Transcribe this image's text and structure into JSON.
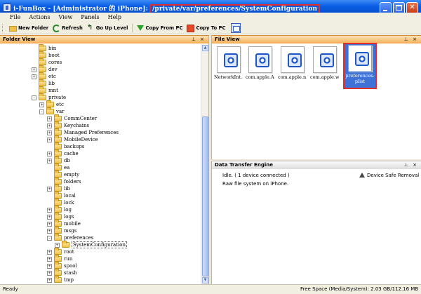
{
  "window": {
    "title_prefix": "i-FunBox - [Administrator 的 iPhone]:",
    "title_path": "/private/var/preferences/SystemConfiguration"
  },
  "menu": [
    "File",
    "Actions",
    "View",
    "Panels",
    "Help"
  ],
  "toolbar": {
    "new_folder": "New Folder",
    "refresh": "Refresh",
    "go_up": "Go Up Level",
    "copy_from_pc": "Copy From PC",
    "copy_to_pc": "Copy To PC"
  },
  "folder_view": {
    "title": "Folder View",
    "tree": [
      {
        "label": "bin",
        "expander": "none",
        "depth": 0
      },
      {
        "label": "boot",
        "expander": "none",
        "depth": 0
      },
      {
        "label": "cores",
        "expander": "none",
        "depth": 0
      },
      {
        "label": "dev",
        "expander": "+",
        "depth": 0
      },
      {
        "label": "etc",
        "expander": "+",
        "depth": 0
      },
      {
        "label": "lib",
        "expander": "none",
        "depth": 0
      },
      {
        "label": "mnt",
        "expander": "none",
        "depth": 0
      },
      {
        "label": "private",
        "expander": "-",
        "depth": 0
      },
      {
        "label": "etc",
        "expander": "+",
        "depth": 1
      },
      {
        "label": "var",
        "expander": "-",
        "depth": 1
      },
      {
        "label": "CommCenter",
        "expander": "+",
        "depth": 2
      },
      {
        "label": "Keychains",
        "expander": "+",
        "depth": 2
      },
      {
        "label": "Managed Preferences",
        "expander": "+",
        "depth": 2
      },
      {
        "label": "MobileDevice",
        "expander": "+",
        "depth": 2
      },
      {
        "label": "backups",
        "expander": "none",
        "depth": 2
      },
      {
        "label": "cache",
        "expander": "+",
        "depth": 2
      },
      {
        "label": "db",
        "expander": "+",
        "depth": 2
      },
      {
        "label": "ea",
        "expander": "none",
        "depth": 2
      },
      {
        "label": "empty",
        "expander": "none",
        "depth": 2
      },
      {
        "label": "folders",
        "expander": "none",
        "depth": 2
      },
      {
        "label": "lib",
        "expander": "+",
        "depth": 2
      },
      {
        "label": "local",
        "expander": "none",
        "depth": 2
      },
      {
        "label": "lock",
        "expander": "none",
        "depth": 2
      },
      {
        "label": "log",
        "expander": "+",
        "depth": 2
      },
      {
        "label": "logs",
        "expander": "+",
        "depth": 2
      },
      {
        "label": "mobile",
        "expander": "+",
        "depth": 2
      },
      {
        "label": "msgs",
        "expander": "+",
        "depth": 2
      },
      {
        "label": "preferences",
        "expander": "-",
        "depth": 2
      },
      {
        "label": "SystemConfiguration",
        "expander": "+",
        "depth": 3,
        "selected": true
      },
      {
        "label": "root",
        "expander": "+",
        "depth": 2
      },
      {
        "label": "run",
        "expander": "+",
        "depth": 2
      },
      {
        "label": "spool",
        "expander": "+",
        "depth": 2
      },
      {
        "label": "stash",
        "expander": "+",
        "depth": 2
      },
      {
        "label": "tmp",
        "expander": "+",
        "depth": 2
      }
    ]
  },
  "file_view": {
    "title": "File View",
    "files": [
      {
        "label": "NetworkInt...",
        "selected": false
      },
      {
        "label": "com.apple.A...",
        "selected": false
      },
      {
        "label": "com.apple.n...",
        "selected": false
      },
      {
        "label": "com.apple.w...",
        "selected": false
      },
      {
        "label": "preferences.plist",
        "selected": true
      }
    ]
  },
  "transfer": {
    "title": "Data Transfer Engine",
    "status": "Idle.  ( 1 device connected )",
    "mode": "Raw file system on iPhone.",
    "safe_removal": "Device Safe Removal"
  },
  "statusbar": {
    "left": "Ready",
    "right": "Free Space (Media/System): 2.03 GB/112.16 MB"
  },
  "colors": {
    "titlebar": "#0a5ee3",
    "highlight_box": "#e22b2b",
    "panel_header": "#f5ad55",
    "selection": "#3e72d6"
  }
}
